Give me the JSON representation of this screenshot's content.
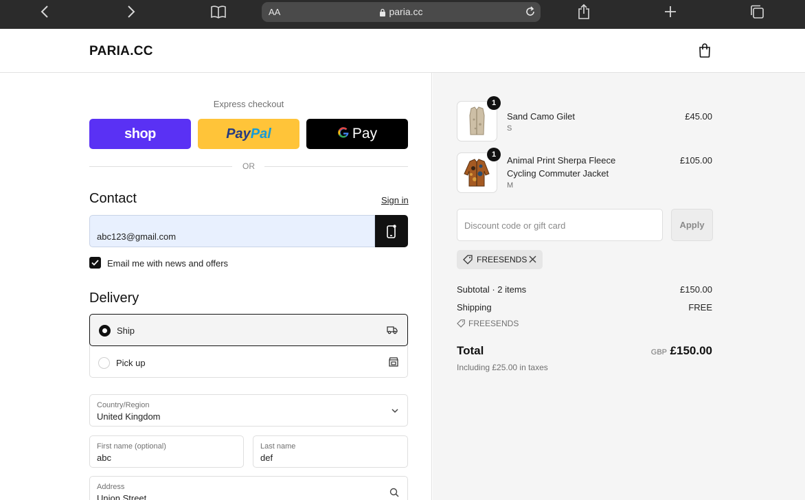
{
  "browser": {
    "aa_label": "AA",
    "url": "paria.cc"
  },
  "header": {
    "logo": "PARIA.CC"
  },
  "express": {
    "title": "Express checkout",
    "shop_label": "shop",
    "paypal_part1": "Pay",
    "paypal_part2": "Pal",
    "gpay_g": "G",
    "gpay_label": "Pay",
    "or_label": "OR"
  },
  "contact": {
    "title": "Contact",
    "sign_in": "Sign in",
    "email_value": "abc123@gmail.com",
    "newsletter_label": "Email me with news and offers"
  },
  "delivery": {
    "title": "Delivery",
    "options": [
      {
        "label": "Ship"
      },
      {
        "label": "Pick up"
      }
    ]
  },
  "address": {
    "country_label": "Country/Region",
    "country_value": "United Kingdom",
    "first_name_label": "First name (optional)",
    "first_name_value": "abc",
    "last_name_label": "Last name",
    "last_name_value": "def",
    "address_label": "Address",
    "address_value": "Union Street"
  },
  "order": {
    "items": [
      {
        "name": "Sand Camo Gilet",
        "variant": "S",
        "price": "£45.00",
        "quantity": "1"
      },
      {
        "name": "Animal Print Sherpa Fleece Cycling Commuter Jacket",
        "variant": "M",
        "price": "£105.00",
        "quantity": "1"
      }
    ],
    "discount_placeholder": "Discount code or gift card",
    "apply_label": "Apply",
    "applied_code": "FREESENDS",
    "subtotal_label": "Subtotal · 2 items",
    "subtotal_value": "£150.00",
    "shipping_label": "Shipping",
    "shipping_value": "FREE",
    "shipping_code": "FREESENDS",
    "total_label": "Total",
    "currency": "GBP",
    "total_value": "£150.00",
    "tax_note": "Including £25.00 in taxes"
  },
  "colors": {
    "shop_pay": "#5a31f4",
    "paypal": "#ffc439",
    "email_fill": "#e8f0fe"
  }
}
